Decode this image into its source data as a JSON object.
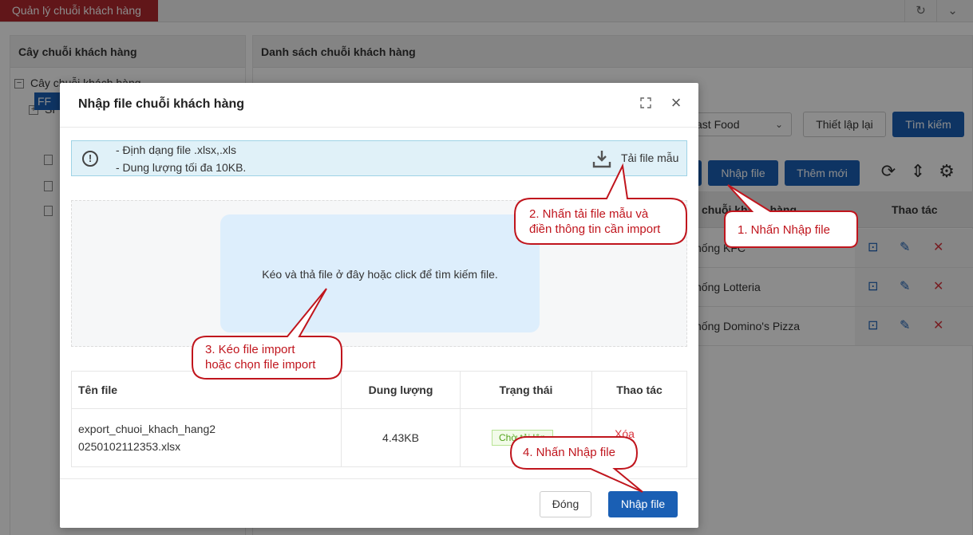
{
  "app": {
    "tab_title": "Quản lý chuỗi khách hàng"
  },
  "left_panel": {
    "title": "Cây chuỗi khách hàng",
    "tree": [
      {
        "label": "Cây chuỗi khách hàng",
        "toggle": "−"
      },
      {
        "label": "SP",
        "toggle": "+"
      },
      {
        "label": "FF",
        "selected": true
      }
    ]
  },
  "right_panel": {
    "title": "Danh sách chuỗi khách hàng",
    "filter_select_value": "ast Food",
    "reset_label": "Thiết lập lại",
    "search_label": "Tìm kiếm",
    "import_label": "Nhập file",
    "add_label": "Thêm mới",
    "col_name": "chuỗi khách hàng",
    "col_actions": "Thao tác",
    "rows": [
      {
        "name": "hống KFC"
      },
      {
        "name": "hống Lotteria"
      },
      {
        "name": "hống Domino's Pizza"
      }
    ]
  },
  "modal": {
    "title": "Nhập file chuỗi khách hàng",
    "info_lines": [
      "- Định dạng file .xlsx,.xls",
      "- Dung lượng tối đa 10KB."
    ],
    "download_label": "Tải file mẫu",
    "dropzone_text": "Kéo và thả file ở đây hoặc click để tìm kiếm file.",
    "table": {
      "headers": [
        "Tên file",
        "Dung lượng",
        "Trạng thái",
        "Thao tác"
      ],
      "row": {
        "file_name_line1": "export_chuoi_khach_hang2",
        "file_name_line2": "0250102112353.xlsx",
        "size": "4.43KB",
        "status": "Chờ tải lên",
        "action": "Xóa"
      }
    },
    "close_label": "Đóng",
    "submit_label": "Nhập file"
  },
  "callouts": {
    "step1": "1. Nhấn Nhập file",
    "step2_line1": "2. Nhấn tải file mẫu và",
    "step2_line2": "điền thông tin cần import",
    "step3_line1": "3. Kéo file import",
    "step3_line2": "hoặc chọn file import",
    "step4": "4. Nhấn Nhập file"
  },
  "colors": {
    "brand_red": "#b1282e",
    "primary_blue": "#1a5fb4",
    "callout_red": "#c0151d",
    "info_bg": "#e0f1f8",
    "dropzone_bg": "#ddeefc"
  }
}
